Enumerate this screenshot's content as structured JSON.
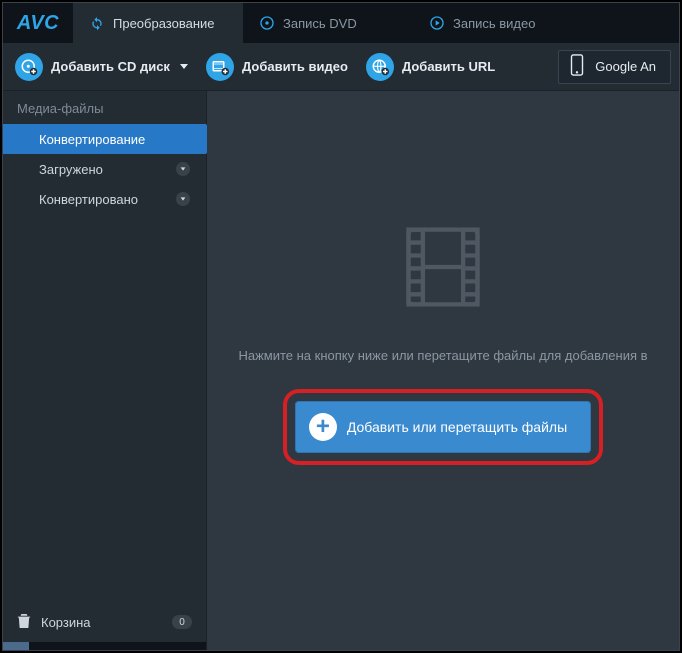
{
  "logo": "AVC",
  "tabs": [
    {
      "label": "Преобразование"
    },
    {
      "label": "Запись DVD"
    },
    {
      "label": "Запись видео"
    }
  ],
  "toolbar": {
    "add_cd": "Добавить CD диск",
    "add_video": "Добавить видео",
    "add_url": "Добавить URL",
    "device": "Google An"
  },
  "sidebar": {
    "title": "Медиа-файлы",
    "items": [
      {
        "label": "Конвертирование"
      },
      {
        "label": "Загружено"
      },
      {
        "label": "Конвертировано"
      }
    ],
    "trash": "Корзина",
    "trash_count": "0"
  },
  "main": {
    "hint": "Нажмите на кнопку ниже или перетащите файлы для добавления в",
    "add_btn": "Добавить или перетащить файлы"
  }
}
